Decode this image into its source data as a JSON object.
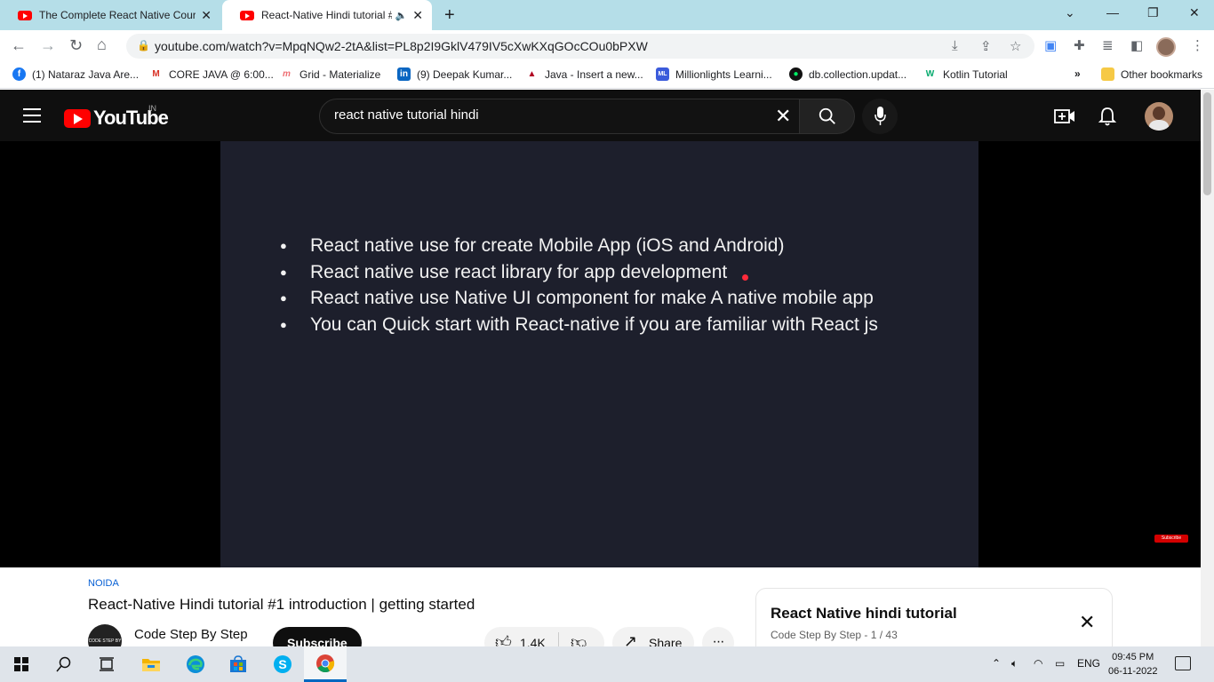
{
  "browser": {
    "tabs": [
      {
        "title": "The Complete React Native Cour",
        "active": false
      },
      {
        "title": "React-Native Hindi tutorial #",
        "active": true
      }
    ],
    "new_tab_label": "+",
    "url": "youtube.com/watch?v=MpqNQw2-2tA&list=PL8p2I9GklV479IV5cXwKXqGOcCOu0bPXW",
    "bookmarks": [
      {
        "label": "(1) Nataraz Java Are...",
        "icon": "facebook-icon",
        "color": "#1877f2"
      },
      {
        "label": "CORE JAVA @ 6:00...",
        "icon": "gmail-icon",
        "color": "#d93025"
      },
      {
        "label": "Grid - Materialize",
        "icon": "materialize-icon",
        "color": "#ee6e73"
      },
      {
        "label": "(9) Deepak Kumar...",
        "icon": "linkedin-icon",
        "color": "#0a66c2"
      },
      {
        "label": "Java - Insert a new...",
        "icon": "graduation-cap-icon",
        "color": "#b00020"
      },
      {
        "label": "Millionlights Learni...",
        "icon": "millionlights-icon",
        "color": "#3b5bdb"
      },
      {
        "label": "db.collection.updat...",
        "icon": "mongodb-icon",
        "color": "#00684a"
      },
      {
        "label": "Kotlin Tutorial",
        "icon": "w3schools-icon",
        "color": "#04aa6d"
      }
    ],
    "bookmarks_overflow": "»",
    "other_bookmarks": "Other bookmarks"
  },
  "youtube": {
    "logo_text": "YouTube",
    "region": "IN",
    "search_query": "react native tutorial hindi",
    "accent": "#ff0000"
  },
  "video": {
    "slide_bullets": [
      "React native use for create Mobile App (iOS and Android)",
      "React native  use react library for app development",
      "React native use Native UI component for make A native mobile app",
      "You can Quick start with React-native if you are familiar with React js"
    ],
    "subscribe_watermark": "Subscribe",
    "location": "NOIDA",
    "title": "React-Native Hindi tutorial #1 introduction | getting started",
    "channel": "Code Step By Step",
    "channel_avatar_text": "CODE STEP BY STEP",
    "subscribe_label": "Subscribe",
    "likes": "1.4K",
    "share_label": "Share",
    "more_label": "···"
  },
  "playlist": {
    "title": "React Native hindi tutorial",
    "channel": "Code Step By Step",
    "position": "1 / 43",
    "separator": " - "
  },
  "taskbar": {
    "language": "ENG",
    "time": "09:45 PM",
    "date": "06-11-2022"
  }
}
